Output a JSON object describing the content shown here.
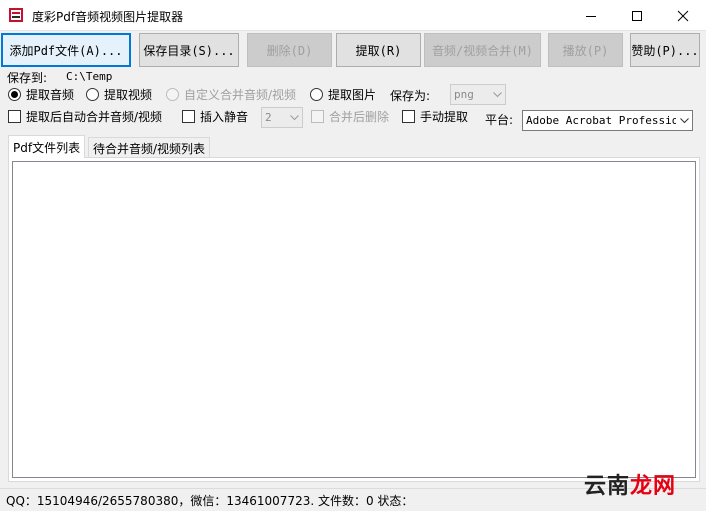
{
  "window": {
    "title": "度彩Pdf音频视频图片提取器"
  },
  "toolbar": {
    "add_pdf": "添加Pdf文件(A)...",
    "save_dir": "保存目录(S)...",
    "delete": "删除(D)",
    "extract": "提取(R)",
    "merge_av": "音频/视频合并(M)",
    "play": "播放(P)",
    "donate": "赞助(P)..."
  },
  "options": {
    "save_to_label": "保存到:",
    "save_to_value": "C:\\Temp",
    "extract_audio": "提取音频",
    "extract_video": "提取视频",
    "custom_merge": "自定义合并音频/视频",
    "extract_image": "提取图片",
    "save_as_label": "保存为:",
    "save_as_value": "png",
    "auto_merge": "提取后自动合并音频/视频",
    "insert_silence": "插入静音",
    "silence_value": "2",
    "delete_after_merge": "合并后删除",
    "manual_extract": "手动提取",
    "platform_label": "平台:",
    "platform_value": "Adobe Acrobat Profession"
  },
  "tabs": [
    {
      "label": "Pdf文件列表"
    },
    {
      "label": "待合并音频/视频列表"
    }
  ],
  "status": {
    "text": "QQ：15104946/2655780380，微信：13461007723.  文件数：0  状态："
  },
  "watermark": {
    "part1": "云南",
    "part2": "龙网"
  },
  "colors": {
    "accent": "#0078d7",
    "background": "#f0f0f0"
  }
}
